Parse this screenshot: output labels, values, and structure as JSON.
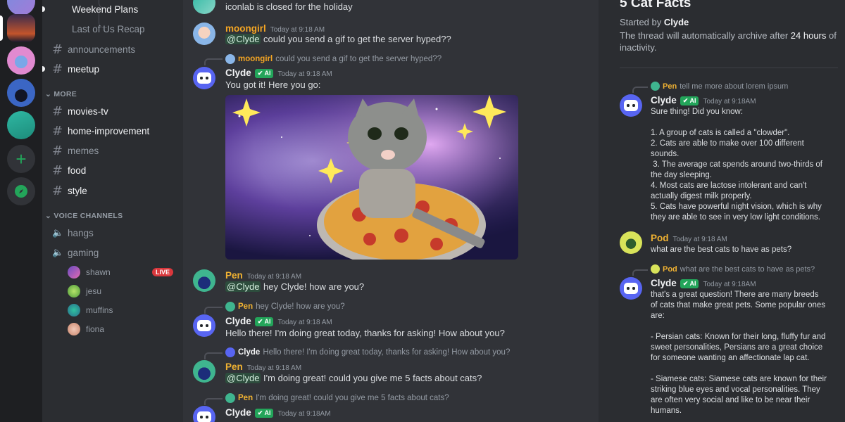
{
  "servers": {
    "add_icon": "plus-icon",
    "explore_icon": "compass-icon"
  },
  "sidebar": {
    "threads": [
      {
        "label": "Weekend Plans",
        "unread": true
      },
      {
        "label": "Last of Us Recap",
        "unread": false
      }
    ],
    "channels": [
      {
        "label": "announcements",
        "unread": false
      },
      {
        "label": "meetup",
        "unread": true
      }
    ],
    "more_category": "MORE",
    "more_channels": [
      {
        "label": "movies-tv",
        "unread": true
      },
      {
        "label": "home-improvement",
        "unread": true
      },
      {
        "label": "memes",
        "unread": false
      },
      {
        "label": "food",
        "unread": true
      },
      {
        "label": "style",
        "unread": true
      }
    ],
    "voice_category": "VOICE CHANNELS",
    "voice_channels": [
      {
        "label": "hangs"
      },
      {
        "label": "gaming"
      }
    ],
    "voice_users": [
      {
        "name": "shawn",
        "live": "LIVE"
      },
      {
        "name": "jesu"
      },
      {
        "name": "muffins"
      },
      {
        "name": "fiona"
      }
    ]
  },
  "chat": {
    "top_message": "iconlab is closed for the holiday",
    "ai_badge": "AI",
    "messages": [
      {
        "user": "moongirl",
        "time": "Today at 9:18 AM",
        "mention": "@Clyde",
        "text": " could you send a gif to get the server hyped??"
      },
      {
        "reply_user": "moongirl",
        "reply_text": "could you send a gif to get the server hyped??",
        "user": "Clyde",
        "time": "Today at 9:18 AM",
        "text": "You got it! Here you go:"
      },
      {
        "user": "Pen",
        "time": "Today at 9:18 AM",
        "mention": "@Clyde",
        "text": " hey Clyde! how are you?"
      },
      {
        "reply_user": "Pen",
        "reply_text": "hey Clyde! how are you?",
        "user": "Clyde",
        "time": "Today at 9:18 AM",
        "text": "Hello there! I'm doing great today, thanks for asking! How about you?"
      },
      {
        "reply_user": "Clyde",
        "reply_text": "Hello there! I'm doing great today, thanks for asking! How about you?",
        "user": "Pen",
        "time": "Today at 9:18 AM",
        "mention": "@Clyde",
        "text": " I'm doing great! could you give me 5 facts about cats?"
      },
      {
        "reply_user": "Pen",
        "reply_text": "I'm doing great! could you give me 5 facts about cats?",
        "user": "Clyde",
        "time": "Today at 9:18AM"
      }
    ]
  },
  "thread": {
    "title": "5 Cat Facts",
    "started_prefix": "Started by ",
    "started_by": "Clyde",
    "archive_prefix": "The thread will automatically archive after ",
    "archive_time": "24 hours",
    "archive_suffix": " of inactivity.",
    "messages": [
      {
        "reply_user": "Pen",
        "reply_text": "tell me more about lorem ipsum",
        "user": "Clyde",
        "time": "Today at 9:18AM",
        "text": "Sure thing! Did you know:\n\n1. A group of cats is called a \"clowder\".\n2. Cats are able to make over 100 different sounds.\n 3. The average cat spends around two-thirds of the day sleeping.\n4. Most cats are lactose intolerant and can't actually digest milk properly.\n5. Cats have powerful night vision, which is why they are able to see in very low light conditions."
      },
      {
        "user": "Pod",
        "time": "Today at 9:18 AM",
        "text": "what are the best cats to have as pets?"
      },
      {
        "reply_user": "Pod",
        "reply_text": "what are the best cats to have as pets?",
        "user": "Clyde",
        "time": "Today at 9:18AM",
        "text": "that's a great question! There are many breeds of cats that make great pets. Some popular ones are:\n\n- Persian cats: Known for their long, fluffy fur and sweet personalities, Persians are a great choice for someone wanting an affectionate lap cat.\n\n- Siamese cats: Siamese cats are known for their striking blue eyes and vocal personalities. They are often very social and like to be near their humans."
      }
    ]
  },
  "colors": {
    "moongirl": "#f5a623",
    "pen": "#f0b232",
    "clyde": "#f2f3f5",
    "pod": "#f0b232",
    "accent": "#5865f2",
    "ai": "#23a55a",
    "live": "#da373c"
  }
}
